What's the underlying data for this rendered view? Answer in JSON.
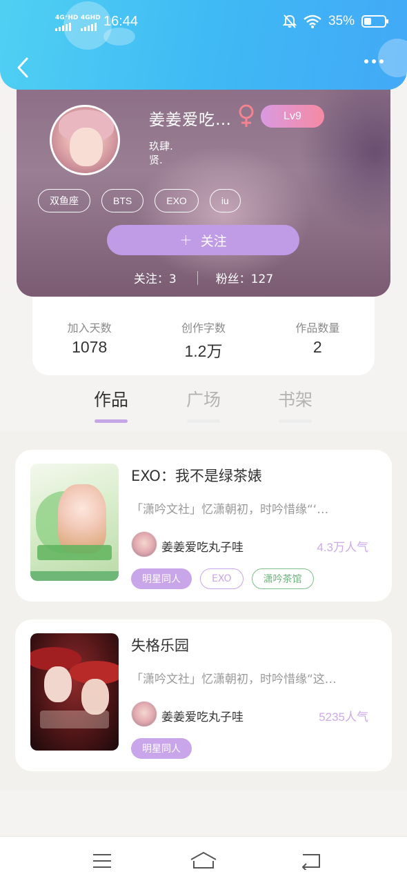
{
  "status_bar": {
    "signal1": "4G⁺HD",
    "signal2": "4GHD",
    "time": "16:44",
    "battery": "35%"
  },
  "profile": {
    "username": "姜姜爱吃…",
    "level": "Lv9",
    "bio_line1": "玖肆.",
    "bio_line2": "贤.",
    "tags": [
      "双鱼座",
      "BTS",
      "EXO",
      "iu"
    ],
    "follow_button": "关注",
    "following_label": "关注：3",
    "followers_label": "粉丝：127"
  },
  "stats": [
    {
      "label": "加入天数",
      "value": "1078"
    },
    {
      "label": "创作字数",
      "value": "1.2万"
    },
    {
      "label": "作品数量",
      "value": "2"
    }
  ],
  "tabs": [
    {
      "label": "作品",
      "active": true
    },
    {
      "label": "广场",
      "active": false
    },
    {
      "label": "书架",
      "active": false
    }
  ],
  "works": [
    {
      "title": "EXO：我不是绿茶婊",
      "description": "「潇吟文社」忆潇朝初，时吟惜缘“‘…",
      "author": "姜姜爱吃丸子哇",
      "popularity": "4.3万人气",
      "tags": [
        "明星同人",
        "EXO",
        "潇吟茶馆"
      ]
    },
    {
      "title": "失格乐园",
      "description": "「潇吟文社」忆潇朝初，时吟惜缘“这…",
      "author": "姜姜爱吃丸子哇",
      "popularity": "5235人气",
      "tags": [
        "明星同人"
      ]
    }
  ]
}
